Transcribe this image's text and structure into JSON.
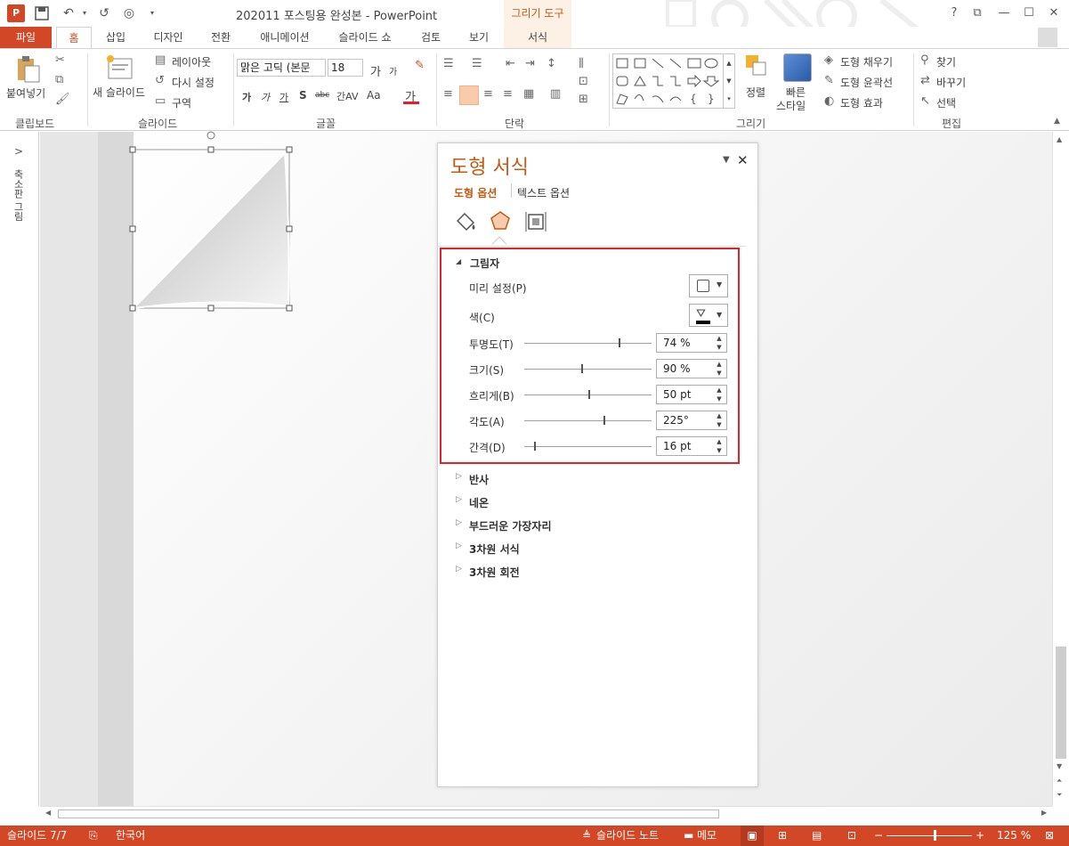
{
  "window": {
    "title": "202011 포스팅용 완성본 - PowerPoint",
    "context_tool": "그리기 도구",
    "help": "?"
  },
  "tabs": [
    "파일",
    "홈",
    "삽입",
    "디자인",
    "전환",
    "애니메이션",
    "슬라이드 쇼",
    "검토",
    "보기",
    "서식"
  ],
  "ribbon": {
    "clipboard": {
      "label": "클립보드",
      "paste": "붙여넣기"
    },
    "slides": {
      "label": "슬라이드",
      "new_slide": "새 슬라이드",
      "layout": "레이아웃",
      "reset": "다시 설정",
      "section": "구역"
    },
    "font": {
      "label": "글꼴",
      "font_name": "맑은 고딕 (본문",
      "font_size": "18",
      "grow": "가",
      "shrink": "가",
      "bold": "가",
      "italic": "가",
      "underline": "가",
      "shadow": "S",
      "strike": "abc",
      "spacing": "간AV",
      "case": "Aa",
      "color": "가"
    },
    "paragraph": {
      "label": "단락"
    },
    "drawing": {
      "label": "그리기",
      "arrange": "정렬",
      "quick_styles_1": "빠른",
      "quick_styles_2": "스타일",
      "fill": "도형 채우기",
      "outline": "도형 윤곽선",
      "effects": "도형 효과"
    },
    "editing": {
      "label": "편집",
      "find": "찾기",
      "replace": "바꾸기",
      "select": "선택"
    }
  },
  "left_pane": {
    "label": "축소판 그림",
    "expand": ">"
  },
  "format_pane": {
    "title": "도형 서식",
    "tab_shape": "도형 옵션",
    "tab_text": "텍스트 옵션",
    "shadow": {
      "header": "그림자",
      "preset_label": "미리 설정(P)",
      "color_label": "색(C)",
      "rows": [
        {
          "label": "투명도(T)",
          "value": "74 %",
          "level": 0.74
        },
        {
          "label": "크기(S)",
          "value": "90 %",
          "level": 0.45
        },
        {
          "label": "흐리게(B)",
          "value": "50 pt",
          "level": 0.5
        },
        {
          "label": "각도(A)",
          "value": "225°",
          "level": 0.625
        },
        {
          "label": "간격(D)",
          "value": "16 pt",
          "level": 0.08
        }
      ]
    },
    "sections": [
      "반사",
      "네온",
      "부드러운 가장자리",
      "3차원 서식",
      "3차원 회전"
    ]
  },
  "status": {
    "slide": "슬라이드 7/7",
    "language": "한국어",
    "notes": "슬라이드 노트",
    "comments": "메모",
    "zoom": "125 %",
    "zoom_level": 0.55
  },
  "colors": {
    "accent": "#d24726",
    "context": "#c55a11",
    "highlight": "#e0202a"
  }
}
